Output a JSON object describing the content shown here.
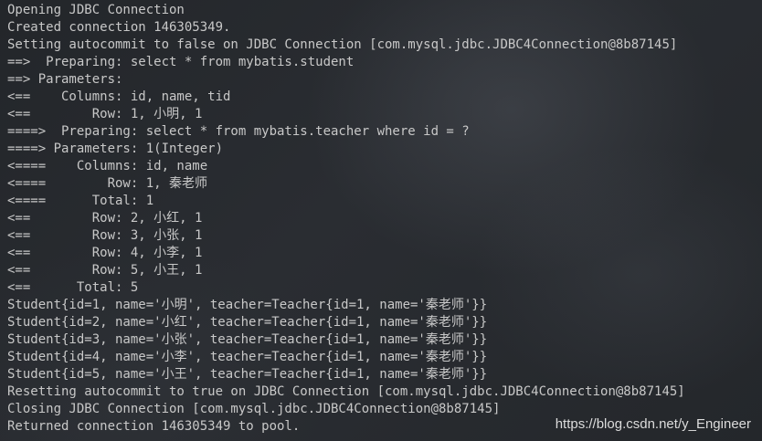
{
  "console": {
    "lines": [
      "Opening JDBC Connection",
      "Created connection 146305349.",
      "Setting autocommit to false on JDBC Connection [com.mysql.jdbc.JDBC4Connection@8b87145]",
      "==>  Preparing: select * from mybatis.student",
      "==> Parameters: ",
      "<==    Columns: id, name, tid",
      "<==        Row: 1, 小明, 1",
      "====>  Preparing: select * from mybatis.teacher where id = ?",
      "====> Parameters: 1(Integer)",
      "<====    Columns: id, name",
      "<====        Row: 1, 秦老师",
      "<====      Total: 1",
      "<==        Row: 2, 小红, 1",
      "<==        Row: 3, 小张, 1",
      "<==        Row: 4, 小李, 1",
      "<==        Row: 5, 小王, 1",
      "<==      Total: 5",
      "Student{id=1, name='小明', teacher=Teacher{id=1, name='秦老师'}}",
      "Student{id=2, name='小红', teacher=Teacher{id=1, name='秦老师'}}",
      "Student{id=3, name='小张', teacher=Teacher{id=1, name='秦老师'}}",
      "Student{id=4, name='小李', teacher=Teacher{id=1, name='秦老师'}}",
      "Student{id=5, name='小王', teacher=Teacher{id=1, name='秦老师'}}",
      "Resetting autocommit to true on JDBC Connection [com.mysql.jdbc.JDBC4Connection@8b87145]",
      "Closing JDBC Connection [com.mysql.jdbc.JDBC4Connection@8b87145]",
      "Returned connection 146305349 to pool."
    ]
  },
  "watermark": "https://blog.csdn.net/y_Engineer",
  "colors": {
    "background": "#25282c",
    "text": "#c8c8c8",
    "watermark": "#dcdcdc"
  }
}
